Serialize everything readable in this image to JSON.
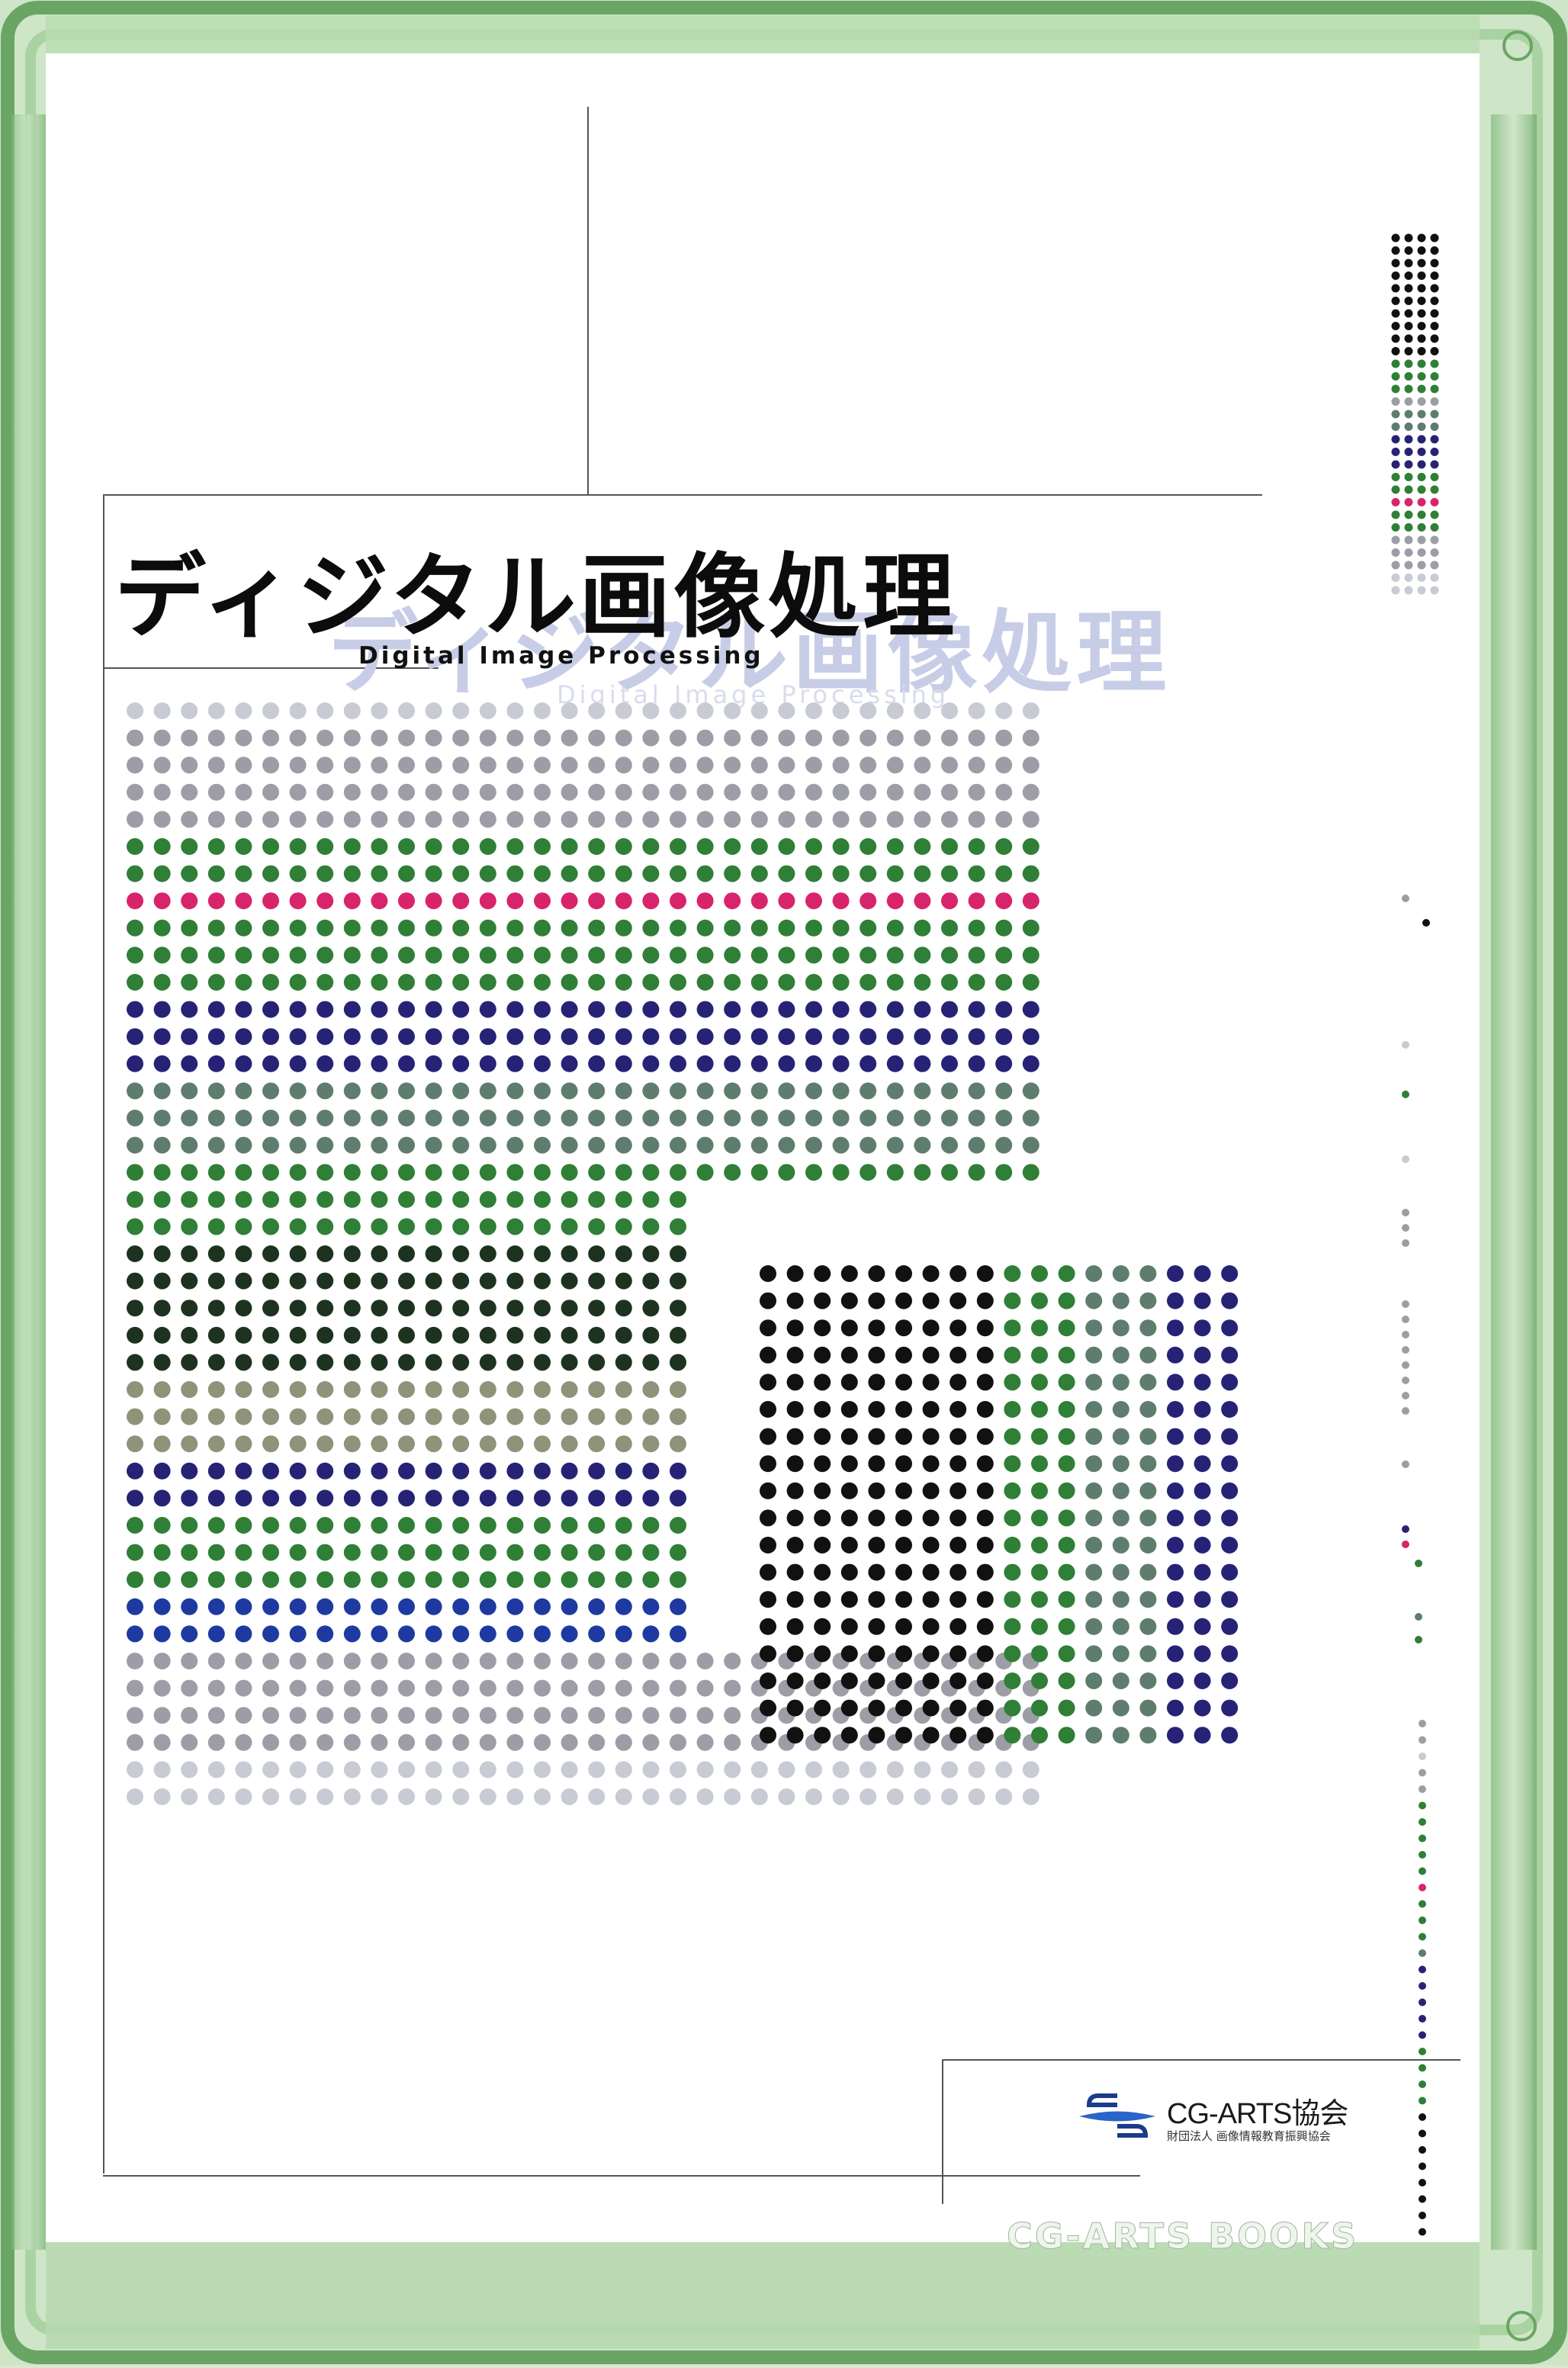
{
  "book": {
    "title": "ディジタル画像処理",
    "subtitle": "Digital Image Processing",
    "publisher": {
      "name": "CG-ARTS協会",
      "org": "財団法人 画像情報教育振興協会"
    },
    "series": "CG-ARTS BOOKS"
  },
  "colors": {
    "case_green": "#8fc488",
    "black": "#111111",
    "green": "#2f7f36",
    "magenta": "#d8246a",
    "navy": "#262376",
    "slate": "#5e7d6e",
    "gray": "#9c9da6",
    "light_gray": "#c8cad4",
    "olive": "#8e9379",
    "dark_green": "#1d3320",
    "blue": "#1e3aa0"
  },
  "dot_grid": {
    "main_rows": [
      "light_gray",
      "gray",
      "gray",
      "gray",
      "gray",
      "green",
      "green",
      "magenta",
      "green",
      "green",
      "green",
      "navy",
      "navy",
      "navy",
      "slate",
      "slate",
      "slate",
      "green",
      "green",
      "green",
      "dark_green",
      "dark_green",
      "dark_green",
      "dark_green",
      "dark_green",
      "olive",
      "olive",
      "olive",
      "navy",
      "navy",
      "green",
      "green",
      "green",
      "blue",
      "blue",
      "gray",
      "gray",
      "gray",
      "gray",
      "light_gray",
      "light_gray"
    ],
    "inset_columns": [
      "black",
      "black",
      "black",
      "black",
      "black",
      "black",
      "black",
      "black",
      "black",
      "green",
      "green",
      "green",
      "slate",
      "slate",
      "slate",
      "navy",
      "navy",
      "navy"
    ],
    "strip_rows": [
      "black",
      "black",
      "black",
      "black",
      "black",
      "black",
      "black",
      "black",
      "black",
      "black",
      "green",
      "green",
      "green",
      "gray",
      "slate",
      "slate",
      "navy",
      "navy",
      "navy",
      "green",
      "green",
      "magenta",
      "green",
      "green",
      "gray",
      "gray",
      "gray",
      "light_gray",
      "light_gray"
    ]
  }
}
